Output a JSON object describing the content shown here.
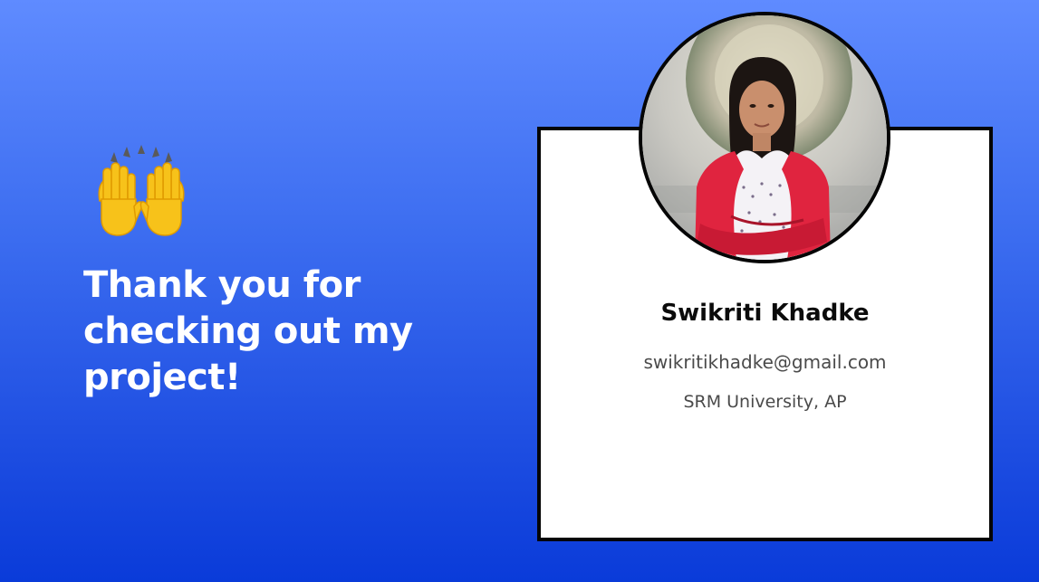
{
  "message": {
    "emoji_icon": "raising-hands-icon",
    "heading": "Thank you for checking out my project!"
  },
  "profile": {
    "name": "Swikriti Khadke",
    "email": "swikritikhadke@gmail.com",
    "institution": "SRM University, AP",
    "photo_icon": "profile-photo"
  },
  "colors": {
    "background_top": "#5f8bff",
    "background_bottom": "#0a3bd9",
    "card_background": "#ffffff",
    "card_border": "#050505",
    "heading_text": "#ffffff",
    "name_text": "#0b0b0b",
    "detail_text": "#4a4a4a"
  }
}
